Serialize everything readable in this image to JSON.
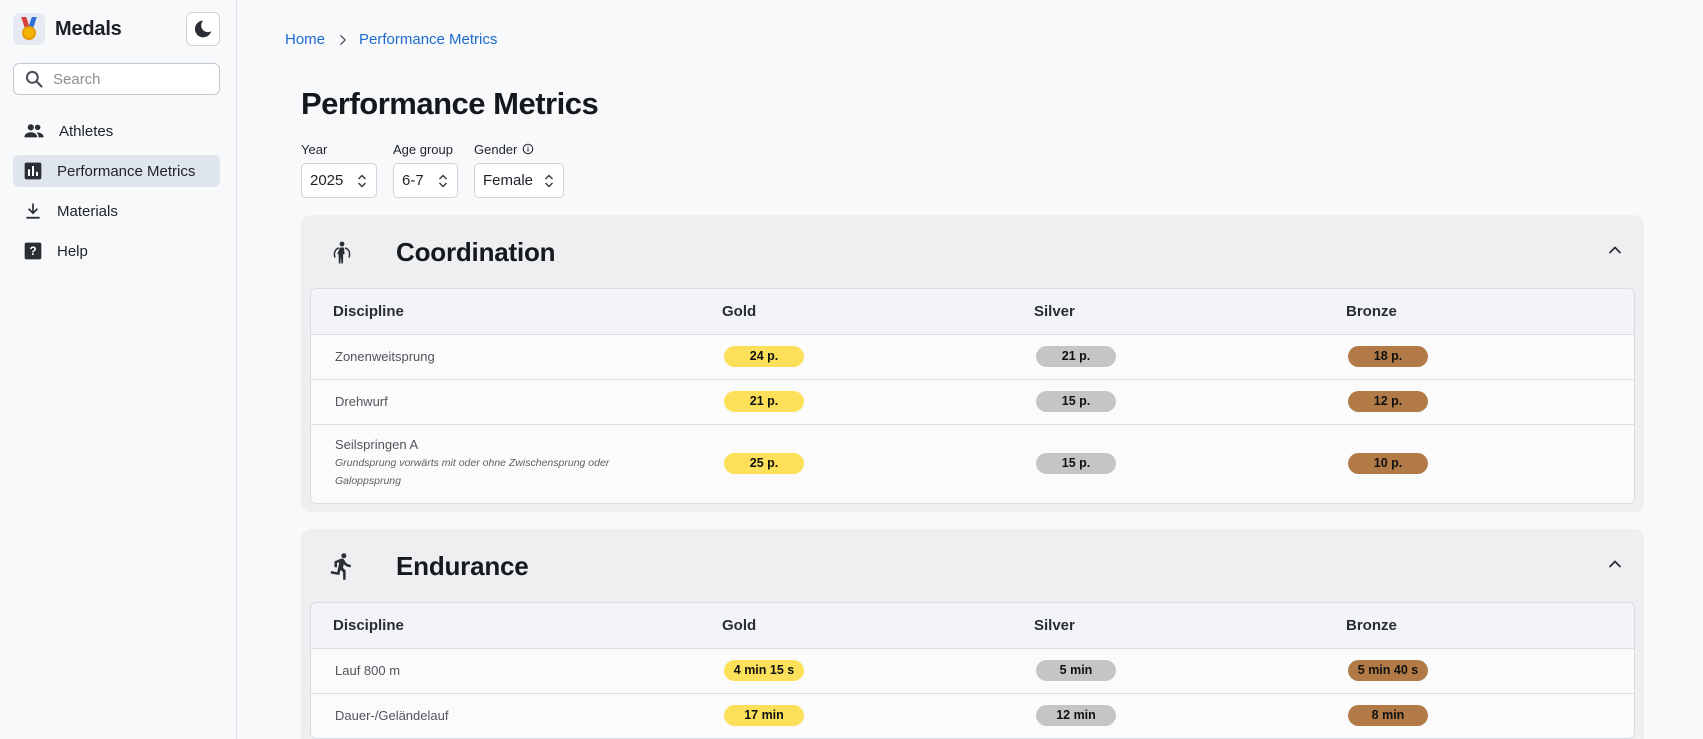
{
  "brand": {
    "title": "Medals"
  },
  "search": {
    "placeholder": "Search"
  },
  "nav": {
    "items": [
      {
        "label": "Athletes",
        "icon": "people-icon",
        "active": false
      },
      {
        "label": "Performance Metrics",
        "icon": "bar-chart-icon",
        "active": true
      },
      {
        "label": "Materials",
        "icon": "download-icon",
        "active": false
      },
      {
        "label": "Help",
        "icon": "help-icon",
        "active": false
      }
    ]
  },
  "breadcrumb": {
    "home": "Home",
    "current": "Performance Metrics"
  },
  "page": {
    "title": "Performance Metrics"
  },
  "filters": {
    "year": {
      "label": "Year",
      "value": "2025"
    },
    "age_group": {
      "label": "Age group",
      "value": "6-7"
    },
    "gender": {
      "label": "Gender",
      "value": "Female"
    }
  },
  "sections": [
    {
      "title": "Coordination",
      "icon": "jump-rope-icon",
      "headers": {
        "discipline": "Discipline",
        "gold": "Gold",
        "silver": "Silver",
        "bronze": "Bronze"
      },
      "rows": [
        {
          "discipline": "Zonenweitsprung",
          "note": "",
          "gold": "24 p.",
          "silver": "21 p.",
          "bronze": "18 p."
        },
        {
          "discipline": "Drehwurf",
          "note": "",
          "gold": "21 p.",
          "silver": "15 p.",
          "bronze": "12 p."
        },
        {
          "discipline": "Seilspringen A",
          "note": "Grundsprung vorwärts mit oder ohne Zwischensprung oder Galoppsprung",
          "gold": "25 p.",
          "silver": "15 p.",
          "bronze": "10 p."
        }
      ]
    },
    {
      "title": "Endurance",
      "icon": "running-icon",
      "headers": {
        "discipline": "Discipline",
        "gold": "Gold",
        "silver": "Silver",
        "bronze": "Bronze"
      },
      "rows": [
        {
          "discipline": "Lauf 800 m",
          "note": "",
          "gold": "4 min 15 s",
          "silver": "5 min",
          "bronze": "5 min 40 s"
        },
        {
          "discipline": "Dauer-/Geländelauf",
          "note": "",
          "gold": "17 min",
          "silver": "12 min",
          "bronze": "8 min"
        }
      ]
    }
  ],
  "colors": {
    "gold": "#fde05a",
    "silver": "#c5c5c5",
    "bronze": "#b17a47",
    "link": "#1e6bd0",
    "active_nav": "#dfe5ec"
  }
}
